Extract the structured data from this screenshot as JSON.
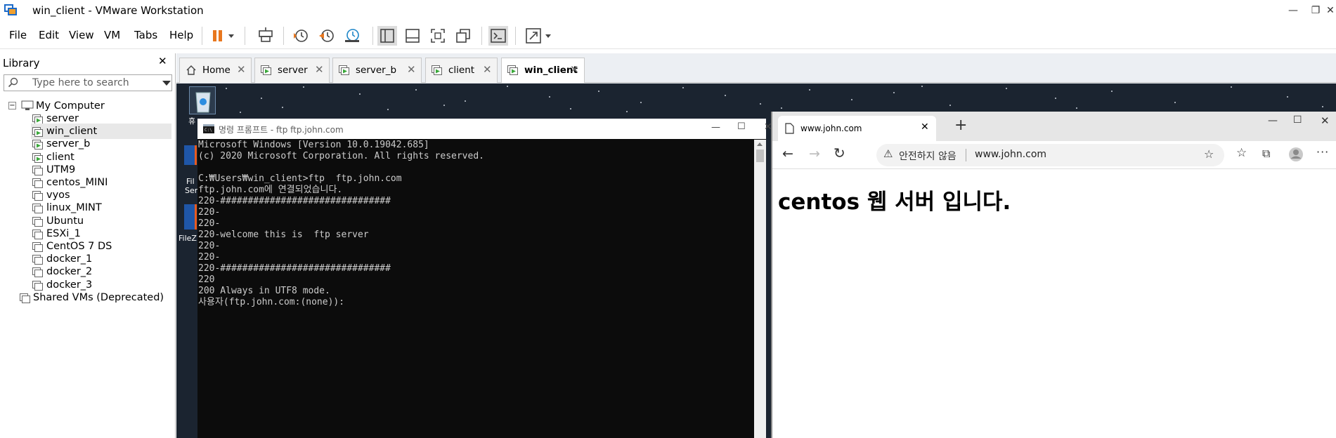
{
  "window": {
    "title": "win_client - VMware Workstation"
  },
  "menu": [
    "File",
    "Edit",
    "View",
    "VM",
    "Tabs",
    "Help"
  ],
  "library": {
    "title": "Library",
    "search_placeholder": "Type here to search",
    "root": "My Computer",
    "vms": [
      {
        "name": "server",
        "running": true
      },
      {
        "name": "win_client",
        "running": true,
        "selected": true
      },
      {
        "name": "server_b",
        "running": true
      },
      {
        "name": "client",
        "running": true
      },
      {
        "name": "UTM9",
        "running": false
      },
      {
        "name": "centos_MINI",
        "running": false
      },
      {
        "name": "vyos",
        "running": false
      },
      {
        "name": "linux_MINT",
        "running": false
      },
      {
        "name": "Ubuntu",
        "running": false
      },
      {
        "name": "ESXi_1",
        "running": false
      },
      {
        "name": "CentOS 7 DS",
        "running": false
      },
      {
        "name": "docker_1",
        "running": false
      },
      {
        "name": "docker_2",
        "running": false
      },
      {
        "name": "docker_3",
        "running": false
      }
    ],
    "shared": "Shared VMs (Deprecated)"
  },
  "tabs": [
    {
      "label": "Home",
      "icon": "home-icon"
    },
    {
      "label": "server",
      "icon": "vm-running-icon"
    },
    {
      "label": "server_b",
      "icon": "vm-running-icon"
    },
    {
      "label": "client",
      "icon": "vm-running-icon"
    },
    {
      "label": "win_client",
      "icon": "vm-running-icon",
      "active": true
    }
  ],
  "desktop": {
    "labels": [
      "휴",
      "Fil",
      "Ser",
      "FileZ"
    ]
  },
  "cmd": {
    "title": "명령 프롬프트 - ftp   ftp.john.com",
    "lines": [
      "Microsoft Windows [Version 10.0.19042.685]",
      "(c) 2020 Microsoft Corporation. All rights reserved.",
      "",
      "C:₩Users₩win_client>ftp  ftp.john.com",
      "ftp.john.com에 연결되었습니다.",
      "220-###############################",
      "220-",
      "220-",
      "220-welcome this is  ftp server",
      "220-",
      "220-",
      "220-###############################",
      "220",
      "200 Always in UTF8 mode.",
      "사용자(ftp.john.com:(none)):"
    ]
  },
  "browser": {
    "tab_title": "www.john.com",
    "security_label": "안전하지 않음",
    "url": "www.john.com",
    "heading": "centos 웹 서버 입니다."
  },
  "colors": {
    "running_green": "#3aa83a",
    "pause_orange": "#e8771e",
    "desktop_bg": "#1b2430"
  }
}
